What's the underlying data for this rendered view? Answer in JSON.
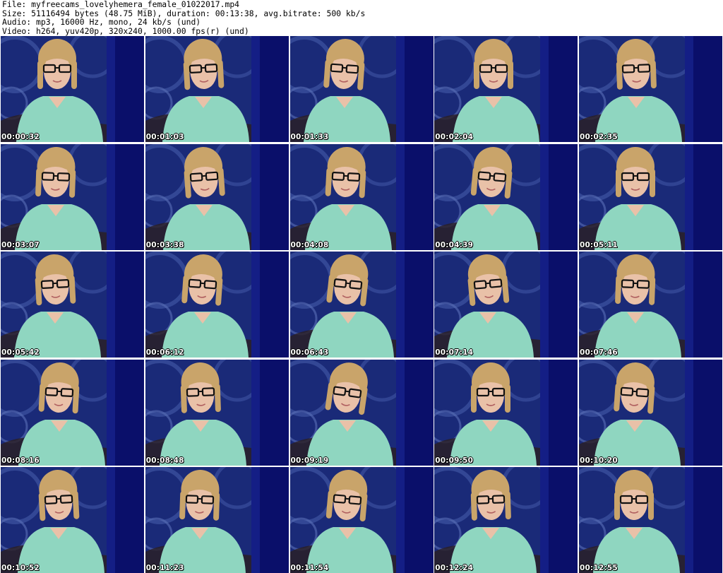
{
  "header": {
    "file": "File: myfreecams_lovelyhemera_female_01022017.mp4",
    "size": "Size: 51116494 bytes (48.75 MiB), duration: 00:13:38, avg.bitrate: 500 kb/s",
    "audio": "Audio: mp3, 16000 Hz, mono, 24 kb/s (und)",
    "video": "Video: h264, yuv420p, 320x240, 1000.00 fps(r) (und)"
  },
  "frames": [
    {
      "timestamp": "00:00:32"
    },
    {
      "timestamp": "00:01:03"
    },
    {
      "timestamp": "00:01:33"
    },
    {
      "timestamp": "00:02:04"
    },
    {
      "timestamp": "00:02:35"
    },
    {
      "timestamp": "00:03:07"
    },
    {
      "timestamp": "00:03:38"
    },
    {
      "timestamp": "00:04:08"
    },
    {
      "timestamp": "00:04:39"
    },
    {
      "timestamp": "00:05:11"
    },
    {
      "timestamp": "00:05:42"
    },
    {
      "timestamp": "00:06:12"
    },
    {
      "timestamp": "00:06:43"
    },
    {
      "timestamp": "00:07:14"
    },
    {
      "timestamp": "00:07:46"
    },
    {
      "timestamp": "00:08:16"
    },
    {
      "timestamp": "00:08:48"
    },
    {
      "timestamp": "00:09:19"
    },
    {
      "timestamp": "00:09:50"
    },
    {
      "timestamp": "00:10:20"
    },
    {
      "timestamp": "00:10:52"
    },
    {
      "timestamp": "00:11:23"
    },
    {
      "timestamp": "00:11:54"
    },
    {
      "timestamp": "00:12:24"
    },
    {
      "timestamp": "00:12:55"
    }
  ],
  "colors": {
    "background_wall": "#0d1470",
    "wall_pattern": "#3a4f9c",
    "sweater": "#8fd6c0",
    "hair": "#c9a46a",
    "skin": "#e9c1a8",
    "glasses": "#111111"
  }
}
